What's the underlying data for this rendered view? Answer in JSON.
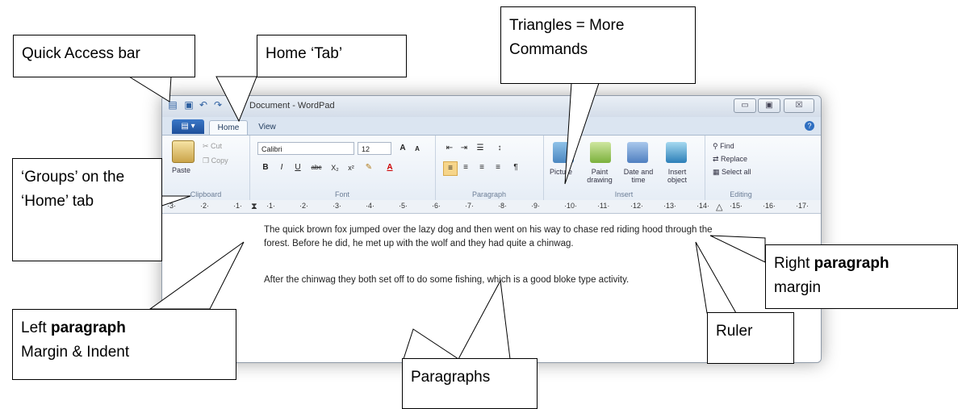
{
  "window": {
    "title": "Document - WordPad",
    "controls": {
      "minimize": "▭",
      "maximize": "▣",
      "close": "☒"
    }
  },
  "tabs": {
    "file": "▤ ▾",
    "home": "Home",
    "view": "View"
  },
  "ribbon": {
    "clipboard": {
      "paste": "Paste",
      "cut": "Cut",
      "copy": "Copy",
      "label": "Clipboard"
    },
    "font": {
      "family": "Calibri",
      "size": "12",
      "grow": "A",
      "shrink": "A",
      "bold": "B",
      "italic": "I",
      "underline": "U",
      "strike": "abc",
      "subscript": "X₂",
      "superscript": "x²",
      "label": "Font"
    },
    "paragraph": {
      "label": "Paragraph"
    },
    "insert": {
      "picture": "Picture",
      "paint": "Paint drawing",
      "datetime": "Date and time",
      "object": "Insert object",
      "label": "Insert"
    },
    "editing": {
      "find": "Find",
      "replace": "Replace",
      "select_all": "Select all",
      "label": "Editing"
    }
  },
  "ruler": {
    "numbers": [
      "·3·",
      "·2·",
      "·1·",
      "·1·",
      "·2·",
      "·3·",
      "·4·",
      "·5·",
      "·6·",
      "·7·",
      "·8·",
      "·9·",
      "·10·",
      "·11·",
      "·12·",
      "·13·",
      "·14·",
      "·15·",
      "·16·",
      "·17·"
    ]
  },
  "document": {
    "paragraphs": [
      "The quick brown fox jumped over the lazy dog and then went on his way to chase red riding hood through the forest.  Before he did, he met up with the wolf and they had quite a chinwag.",
      "After the chinwag they both set off to do some fishing, which is a good bloke type activity."
    ]
  },
  "callouts": {
    "quick_access": "Quick Access bar",
    "home_tab": "Home ‘Tab’",
    "triangles": "Triangles = More Commands",
    "groups": "‘Groups’ on the ‘Home’ tab",
    "right_margin_1": "Right ",
    "right_margin_bold": "paragraph",
    "right_margin_2": "margin",
    "left_margin_1": "Left ",
    "left_margin_bold": "paragraph",
    "left_margin_2": "Margin & Indent",
    "ruler": "Ruler",
    "paragraphs": "Paragraphs"
  }
}
